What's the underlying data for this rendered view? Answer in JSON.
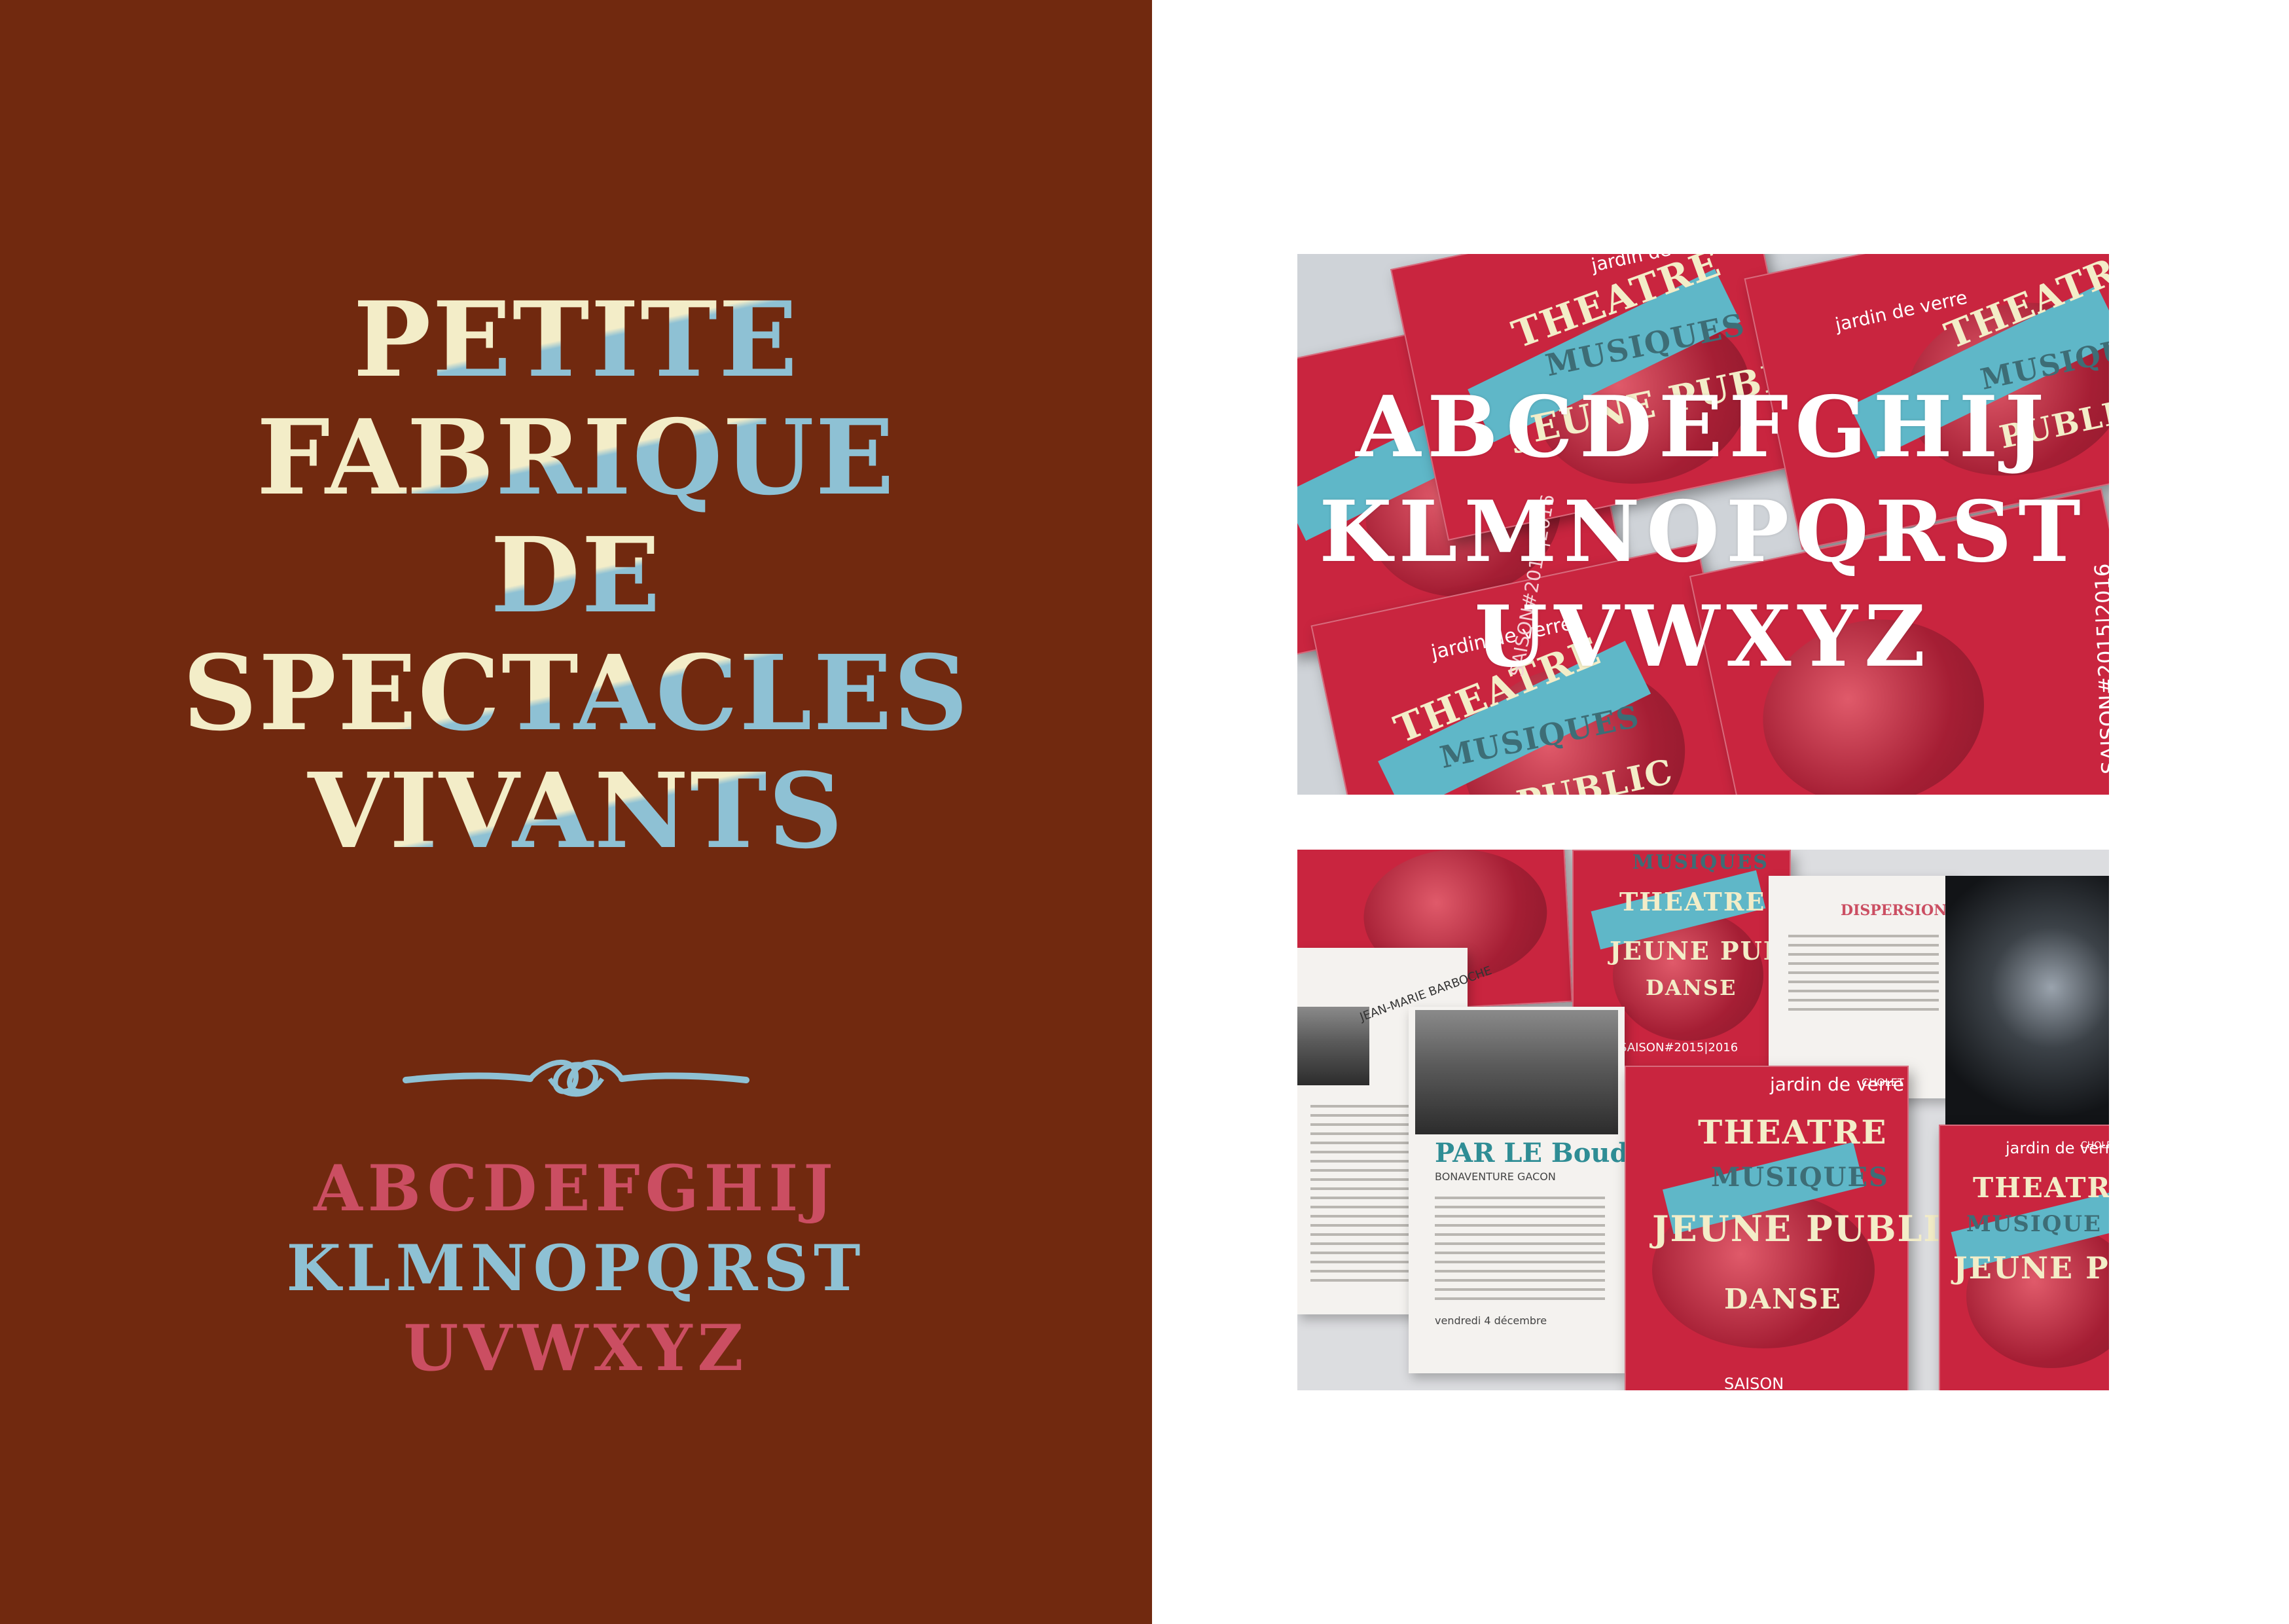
{
  "poster": {
    "title_lines": [
      "PETITE",
      "FABRIQUE",
      "DE",
      "SPECTACLES",
      "VIVANTS"
    ],
    "alphabet_lines": [
      "ABCDEFGHIJ",
      "KLMNOPQRST",
      "UVWXYZ"
    ],
    "colors": {
      "background": "#71290f",
      "cream": "#f3edc8",
      "blue": "#8ec1d4",
      "pink": "#cb4e62"
    }
  },
  "photo_top": {
    "overlay_alphabet": [
      "ABCDEFGHIJ",
      "KLMNOPQRST",
      "UVWXYZ"
    ],
    "covers": [
      {
        "brand": "jardin de verre",
        "words": [
          "THEATRE",
          "MUSIQUES",
          "JEUNE PUBLIC"
        ],
        "season": "SAISON#2015|2016"
      },
      {
        "brand": "jardin de verre",
        "words": [
          "THEATRE",
          "MUSIQUES",
          "PUBLIC"
        ],
        "season": "SAISON#2015|2016"
      },
      {
        "brand": "jardin de verre",
        "words": [
          "THEATRE",
          "MUSIQUES",
          "PUBLIC"
        ],
        "season": "SAISON#2015|2016"
      }
    ]
  },
  "photo_bottom": {
    "left_page": {
      "heading": "PAR LE Boudu",
      "subheading": "BONAVENTURE GACON",
      "date": "vendredi 4 décembre",
      "badge": "JEAN-MARIE BARBOCHE"
    },
    "right_page": {
      "heading": "DISPERSION"
    },
    "cover_center": {
      "words": [
        "THEATRE",
        "MUSIQUES",
        "JEUNE PUBLIC",
        "DANSE"
      ],
      "season": "SAISON#2015|2016"
    },
    "cover_bottom_left": {
      "brand": "jardin de verre",
      "city": "CHOLET",
      "words": [
        "THEATRE",
        "MUSIQUES",
        "JEUNE PUBLIC",
        "DANSE"
      ],
      "season": "SAISON"
    },
    "cover_bottom_right": {
      "brand": "jardin de verre",
      "city": "CHOLET",
      "words": [
        "THEATRE",
        "MUSIQUE",
        "JEUNE PUBLIC"
      ]
    }
  }
}
